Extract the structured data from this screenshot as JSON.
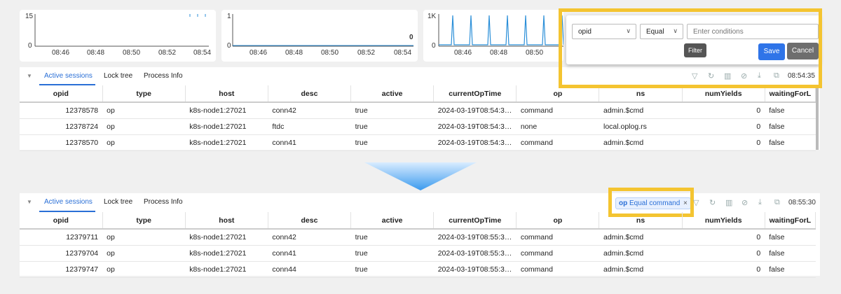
{
  "charts": [
    {
      "y_top": "15",
      "y_zero": "0",
      "ticks": [
        "08:46",
        "08:48",
        "08:50",
        "08:52",
        "08:54"
      ]
    },
    {
      "y_top": "1",
      "y_zero": "0",
      "ticks": [
        "08:46",
        "08:48",
        "08:50",
        "08:52",
        "08:54"
      ],
      "last_value": "0"
    },
    {
      "y_top": "1K",
      "y_zero": "0",
      "ticks": [
        "08:46",
        "08:48",
        "08:50"
      ]
    }
  ],
  "tabs": [
    "Active sessions",
    "Lock tree",
    "Process Info"
  ],
  "columns": [
    "opid",
    "type",
    "host",
    "desc",
    "active",
    "currentOpTime",
    "op",
    "ns",
    "numYields",
    "waitingForL"
  ],
  "top_panel": {
    "time": "08:54:35",
    "rows": [
      [
        "12378578",
        "op",
        "k8s-node1:27021",
        "conn42",
        "true",
        "2024-03-19T08:54:35...",
        "command",
        "admin.$cmd",
        "0",
        "false"
      ],
      [
        "12378724",
        "op",
        "k8s-node1:27021",
        "ftdc",
        "true",
        "2024-03-19T08:54:35...",
        "none",
        "local.oplog.rs",
        "0",
        "false"
      ],
      [
        "12378570",
        "op",
        "k8s-node1:27021",
        "conn41",
        "true",
        "2024-03-19T08:54:35...",
        "command",
        "admin.$cmd",
        "0",
        "false"
      ]
    ]
  },
  "filter_popup": {
    "field": "opid",
    "operator": "Equal",
    "placeholder": "Enter conditions",
    "tooltip": "Filter",
    "save": "Save",
    "cancel": "Cancel",
    "colors": {
      "save": "#2f74e8",
      "cancel": "#6e6e6e",
      "highlight": "#f4c430"
    }
  },
  "bottom_panel": {
    "time": "08:55:30",
    "filter_tag": {
      "field": "op",
      "condition": "Equal command",
      "close": "×"
    },
    "rows": [
      [
        "12379711",
        "op",
        "k8s-node1:27021",
        "conn42",
        "true",
        "2024-03-19T08:55:30...",
        "command",
        "admin.$cmd",
        "0",
        "false"
      ],
      [
        "12379704",
        "op",
        "k8s-node1:27021",
        "conn41",
        "true",
        "2024-03-19T08:55:30...",
        "command",
        "admin.$cmd",
        "0",
        "false"
      ],
      [
        "12379747",
        "op",
        "k8s-node1:27021",
        "conn44",
        "true",
        "2024-03-19T08:55:30...",
        "command",
        "admin.$cmd",
        "0",
        "false"
      ]
    ]
  },
  "icons": [
    "filter-icon",
    "refresh-icon",
    "columns-icon",
    "clear-icon",
    "download-icon",
    "copy-icon",
    "collapse-caret-icon",
    "arrow-down-icon"
  ]
}
